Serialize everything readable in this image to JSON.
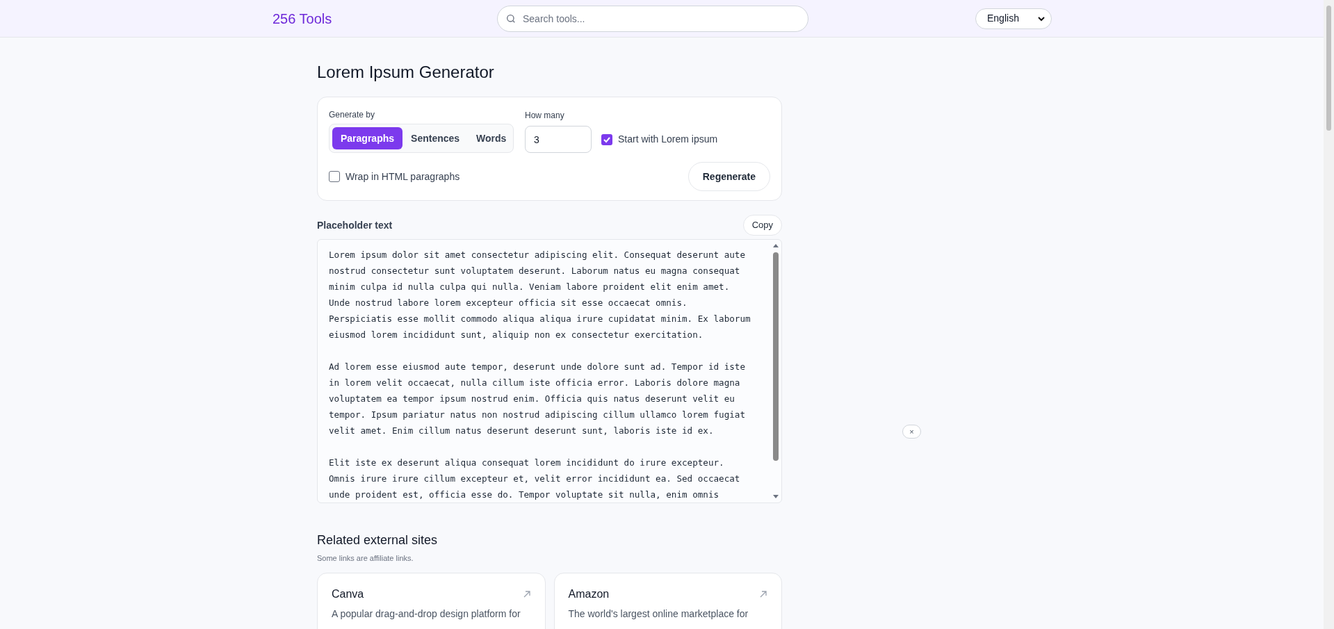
{
  "header": {
    "logo": "256 Tools",
    "search": {
      "placeholder": "Search tools..."
    },
    "language": "English"
  },
  "title": "Lorem Ipsum Generator",
  "options": {
    "generate_by_label": "Generate by",
    "modes": [
      {
        "label": "Paragraphs",
        "selected": true
      },
      {
        "label": "Sentences",
        "selected": false
      },
      {
        "label": "Words",
        "selected": false
      }
    ],
    "how_many_label": "How many",
    "how_many": "3",
    "start_with_lorem": {
      "label": "Start with Lorem ipsum",
      "checked": true
    },
    "wrap_html": {
      "label": "Wrap in HTML paragraphs",
      "checked": false
    },
    "regenerate": "Regenerate"
  },
  "output": {
    "label": "Placeholder text",
    "copy": "Copy",
    "paragraphs": [
      [
        "Lorem ipsum dolor sit amet consectetur adipiscing elit. Consequat deserunt aute",
        "nostrud consectetur sunt voluptatem deserunt. Laborum natus eu magna consequat",
        "minim culpa id nulla culpa qui nulla. Veniam labore proident elit enim amet.",
        "Unde nostrud labore lorem excepteur officia sit esse occaecat omnis.",
        "Perspiciatis esse mollit commodo aliqua aliqua irure cupidatat minim. Ex laborum",
        "eiusmod lorem incididunt sunt, aliquip non ex consectetur exercitation."
      ],
      [
        "Ad lorem esse eiusmod aute tempor, deserunt unde dolore sunt ad. Tempor id iste",
        "in lorem velit occaecat, nulla cillum iste officia error. Laboris dolore magna",
        "voluptatem ea tempor ipsum nostrud enim. Officia quis natus deserunt velit eu",
        "tempor. Ipsum pariatur natus non nostrud adipiscing cillum ullamco lorem fugiat",
        "velit amet. Enim cillum natus deserunt deserunt sunt, laboris iste id ex."
      ],
      [
        "Elit iste ex deserunt aliqua consequat lorem incididunt do irure excepteur.",
        "Omnis irure irure cillum excepteur et, velit error incididunt ea. Sed occaecat",
        "unde proident est, officia esse do. Tempor voluptate sit nulla, enim omnis"
      ]
    ]
  },
  "related": {
    "title": "Related external sites",
    "note": "Some links are affiliate links.",
    "sites": [
      {
        "name": "Canva",
        "description": "A popular drag-and-drop design platform for"
      },
      {
        "name": "Amazon",
        "description": "The world's largest online marketplace for"
      }
    ]
  },
  "close_button": "×"
}
